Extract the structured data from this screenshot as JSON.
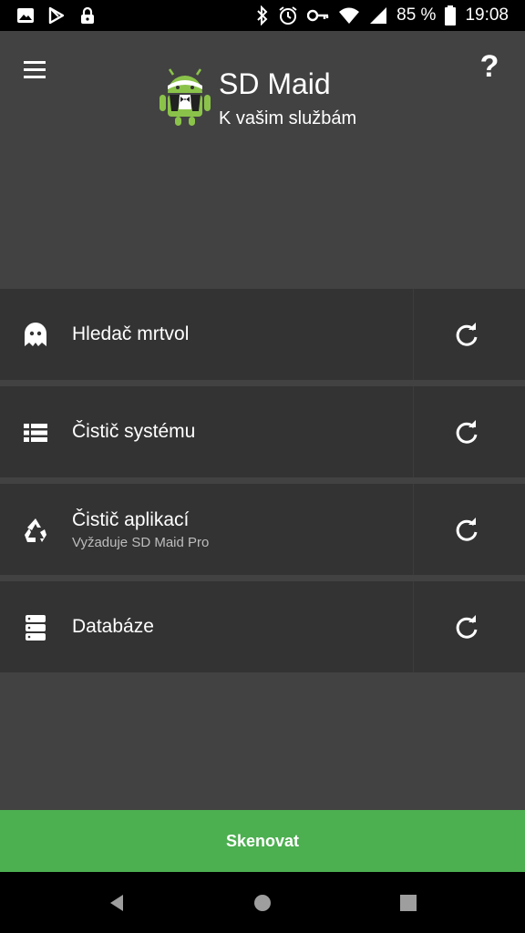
{
  "status_bar": {
    "battery": "85 %",
    "time": "19:08",
    "left_icons": [
      "image-icon",
      "play-store-icon",
      "lock-icon"
    ],
    "right_icons": [
      "bluetooth-icon",
      "alarm-icon",
      "key-icon",
      "wifi-icon",
      "signal-icon",
      "battery-icon"
    ]
  },
  "header": {
    "title": "SD Maid",
    "subtitle": "K vašim službám",
    "help_label": "?"
  },
  "tools": [
    {
      "name": "corpse-finder",
      "label": "Hledač mrtvol",
      "sublabel": "",
      "icon": "ghost-icon"
    },
    {
      "name": "system-cleaner",
      "label": "Čistič systému",
      "sublabel": "",
      "icon": "list-icon"
    },
    {
      "name": "app-cleaner",
      "label": "Čistič aplikací",
      "sublabel": "Vyžaduje SD Maid Pro",
      "icon": "recycle-icon"
    },
    {
      "name": "databases",
      "label": "Databáze",
      "sublabel": "",
      "icon": "database-icon"
    }
  ],
  "scan_label": "Skenovat",
  "colors": {
    "background": "#424242",
    "row": "#333333",
    "accent": "#4caf50",
    "bars": "#000000"
  }
}
